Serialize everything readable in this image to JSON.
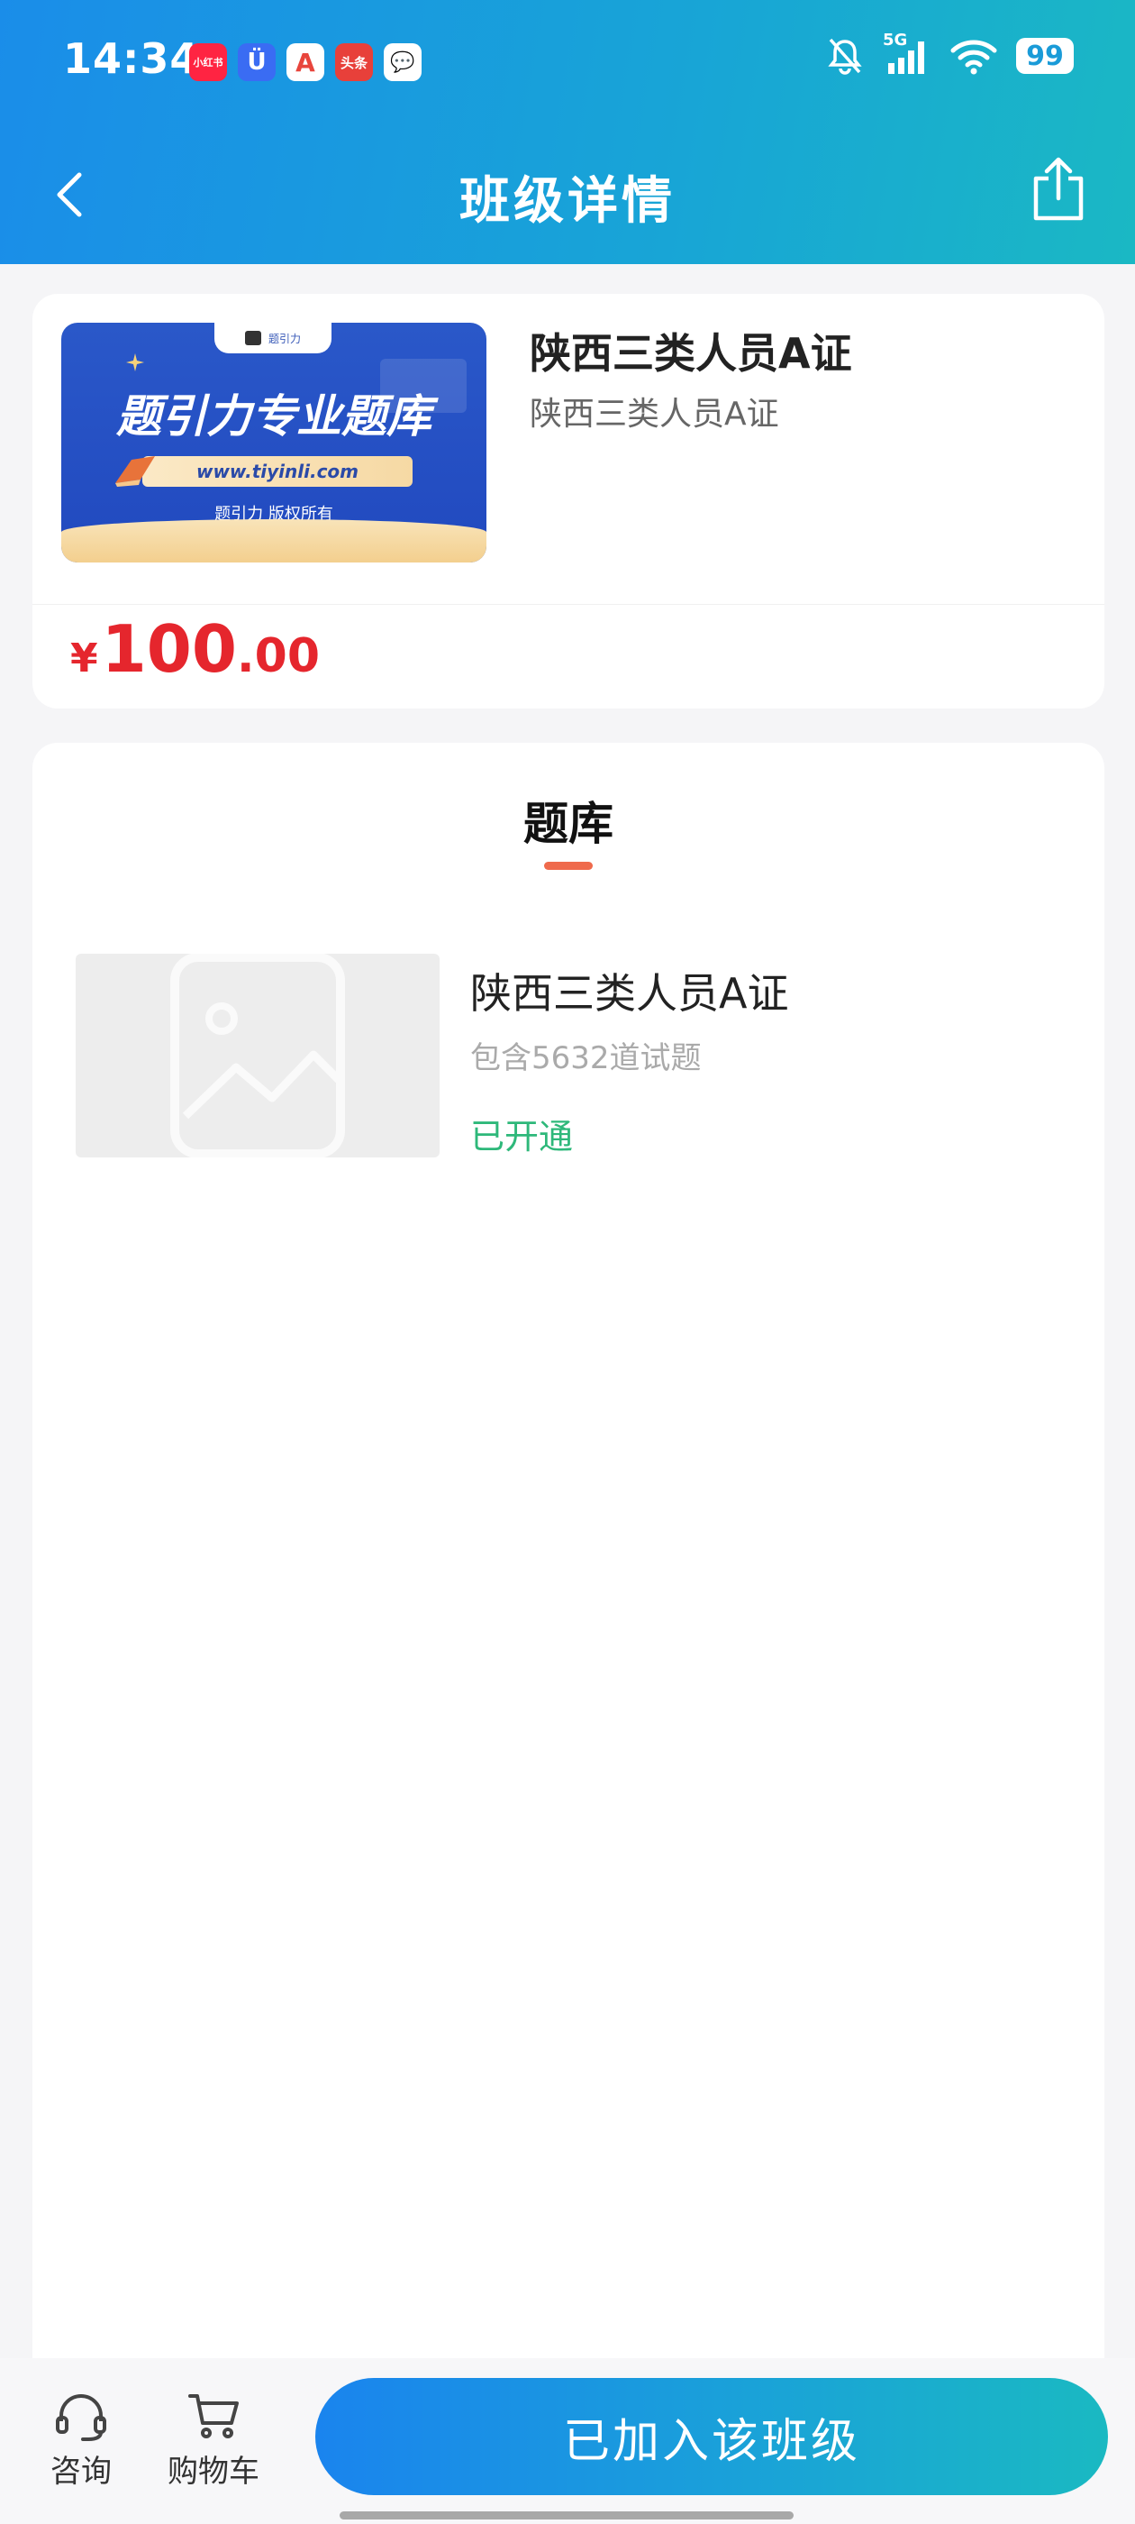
{
  "status_bar": {
    "time": "14:34",
    "apps": [
      {
        "name": "xiaohongshu",
        "label": "小红书",
        "color": "#ff2442"
      },
      {
        "name": "baidu-netdisk",
        "label": "Ü",
        "color": "#3a6cf3"
      },
      {
        "name": "app-a",
        "label": "A",
        "color": "#e8453c"
      },
      {
        "name": "toutiao",
        "label": "头条",
        "color": "#e8403a"
      },
      {
        "name": "chat",
        "label": "💬",
        "color": "#ffffff"
      }
    ],
    "network": "5G",
    "battery": "99"
  },
  "nav": {
    "title": "班级详情"
  },
  "class_card": {
    "cover": {
      "tab_label": "题引力",
      "headline": "题引力专业题库",
      "url": "www.tiyinli.com",
      "copyright": "题引力 版权所有"
    },
    "name": "陕西三类人员A证",
    "subtitle": "陕西三类人员A证",
    "price": {
      "symbol": "¥",
      "integer": "100",
      "decimal": ".00"
    }
  },
  "bank": {
    "title": "题库",
    "items": [
      {
        "name": "陕西三类人员A证",
        "count": "包含5632道试题",
        "status": "已开通"
      }
    ]
  },
  "bottom_bar": {
    "consult_label": "咨询",
    "cart_label": "购物车",
    "join_label": "已加入该班级"
  },
  "colors": {
    "header_start": "#1a8de9",
    "header_end": "#1ab8c4",
    "price": "#e5262d",
    "status_active": "#2eb87a",
    "tab_indicator": "#ef6a4c"
  }
}
